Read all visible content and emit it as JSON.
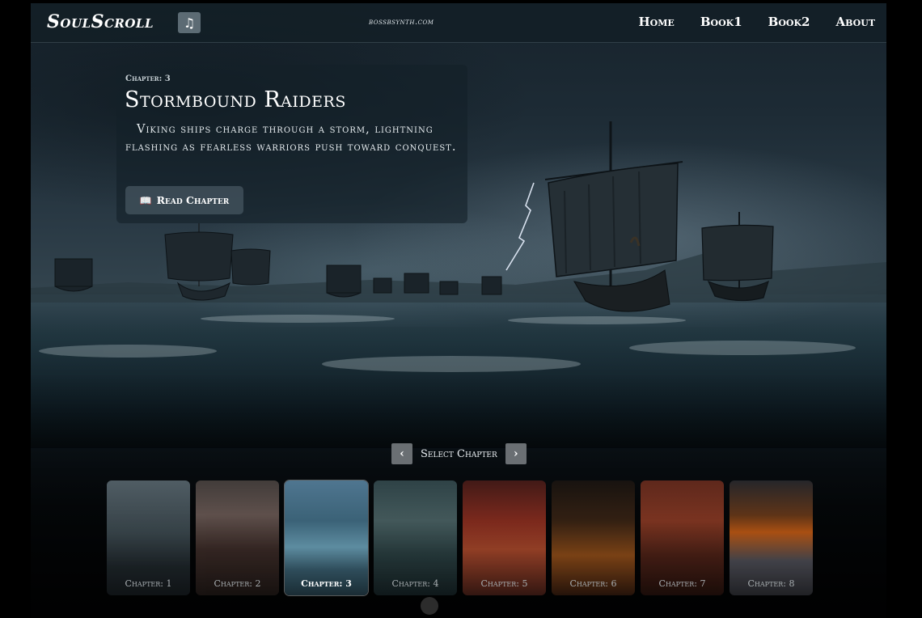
{
  "header": {
    "logo": "SoulScroll",
    "music_icon": "music-note-icon",
    "site_label": "bossbsynth.com",
    "nav": [
      "Home",
      "Book1",
      "Book2",
      "About"
    ]
  },
  "hero": {
    "kicker": "Chapter: 3",
    "title": "Stormbound Raiders",
    "description": "Viking ships charge through a storm, lightning flashing as fearless warriors push toward conquest.",
    "button_icon": "open-book-icon",
    "button_label": "Read Chapter"
  },
  "chapter_selector": {
    "label": "Select Chapter",
    "prev_icon": "chevron-left-icon",
    "next_icon": "chevron-right-icon"
  },
  "chapters": [
    {
      "label": "Chapter: 1",
      "active": false
    },
    {
      "label": "Chapter: 2",
      "active": false
    },
    {
      "label": "Chapter: 3",
      "active": true
    },
    {
      "label": "Chapter: 4",
      "active": false
    },
    {
      "label": "Chapter: 5",
      "active": false
    },
    {
      "label": "Chapter: 6",
      "active": false
    },
    {
      "label": "Chapter: 7",
      "active": false
    },
    {
      "label": "Chapter: 8",
      "active": false
    }
  ]
}
